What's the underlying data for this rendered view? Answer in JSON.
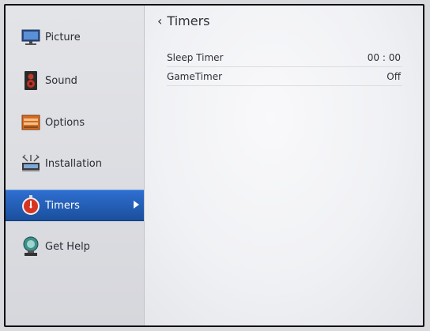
{
  "sidebar": {
    "items": [
      {
        "label": "Picture",
        "icon": "monitor-icon"
      },
      {
        "label": "Sound",
        "icon": "speaker-icon"
      },
      {
        "label": "Options",
        "icon": "options-icon"
      },
      {
        "label": "Installation",
        "icon": "antenna-icon"
      },
      {
        "label": "Timers",
        "icon": "stopwatch-icon",
        "selected": true
      },
      {
        "label": "Get Help",
        "icon": "help-icon"
      }
    ]
  },
  "panel": {
    "title": "Timers",
    "rows": [
      {
        "label": "Sleep Timer",
        "value": "00 : 00"
      },
      {
        "label": "GameTimer",
        "value": "Off"
      }
    ]
  },
  "colors": {
    "selection": "#2160c0",
    "sidebar_bg": "#dfe0e4",
    "panel_bg": "#f3f4f6"
  }
}
